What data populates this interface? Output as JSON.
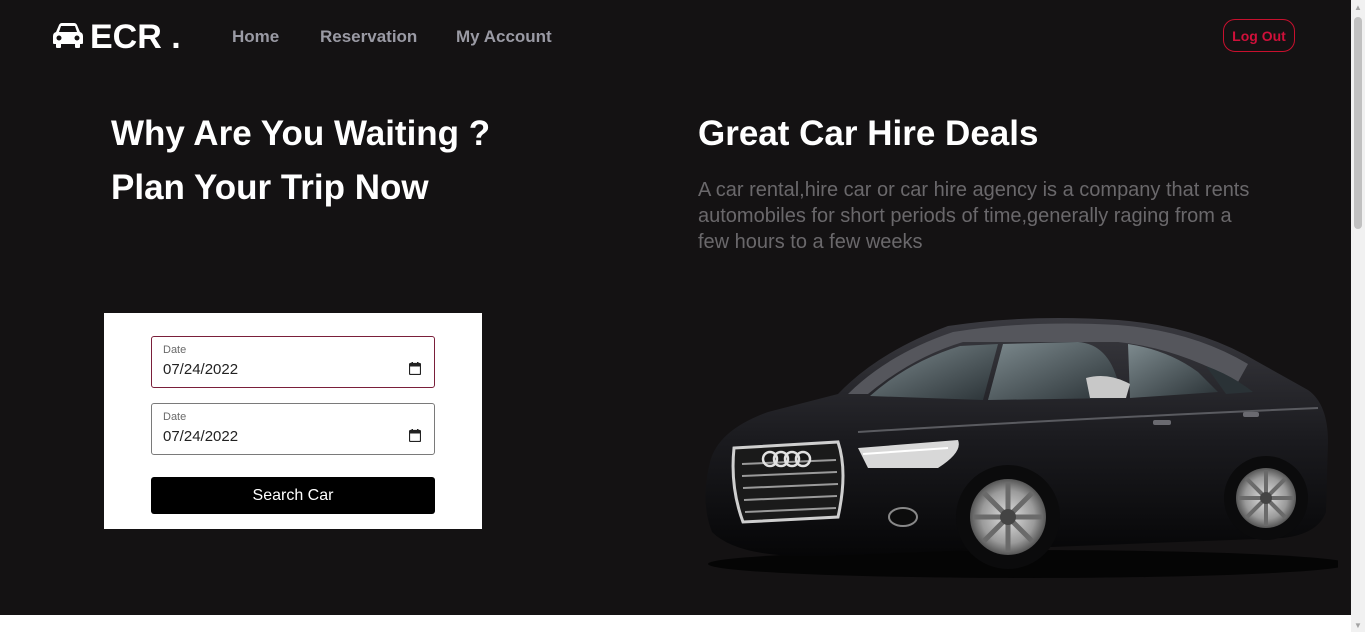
{
  "brand": {
    "name": "ECR .",
    "icon": "car-icon"
  },
  "nav": {
    "links": [
      "Home",
      "Reservation",
      "My Account"
    ],
    "logout_label": "Log Out"
  },
  "hero": {
    "headline_line1": "Why Are You Waiting ?",
    "headline_line2": "Plan Your Trip Now",
    "deals_title": "Great Car Hire Deals",
    "deals_description": "A car rental,hire car or car hire agency is a company that rents automobiles for short periods of time,generally raging from a few hours to a few weeks"
  },
  "search_form": {
    "pickup": {
      "label": "Date",
      "value": "07/24/2022",
      "icon": "calendar-icon"
    },
    "return": {
      "label": "Date",
      "value": "07/24/2022",
      "icon": "calendar-icon"
    },
    "submit_label": "Search Car"
  },
  "colors": {
    "background": "#141213",
    "accent": "#c8102e",
    "nav_text": "#9a9aa4",
    "muted_text": "#6a686b"
  }
}
